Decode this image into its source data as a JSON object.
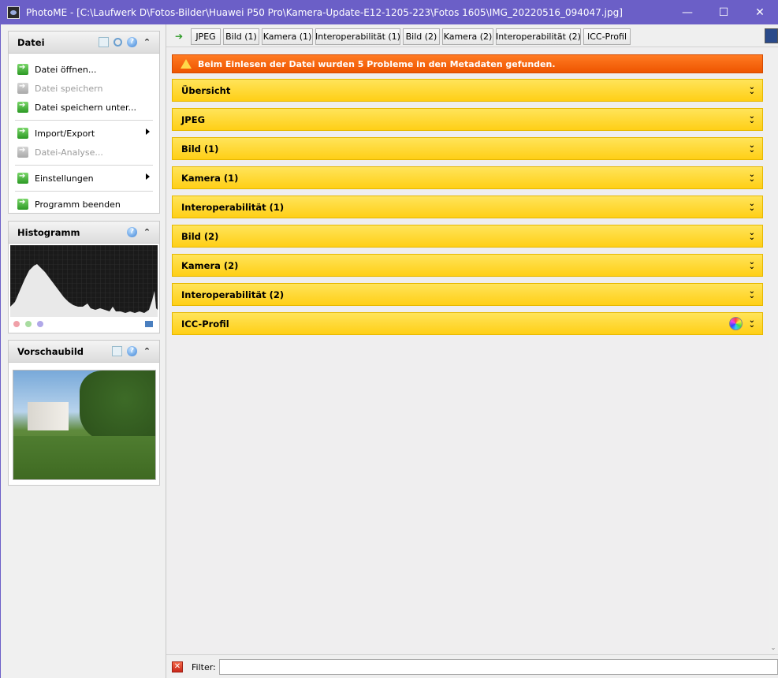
{
  "window": {
    "title": "PhotoME - [C:\\Laufwerk  D\\Fotos-Bilder\\Huawei P50 Pro\\Kamera-Update-E12-1205-223\\Fotos 1605\\IMG_20220516_094047.jpg]",
    "minimize_glyph": "—",
    "maximize_glyph": "☐",
    "close_glyph": "✕"
  },
  "sidebar": {
    "datei": {
      "title": "Datei",
      "items": [
        {
          "label": "Datei öffnen...",
          "enabled": true
        },
        {
          "label": "Datei speichern",
          "enabled": false
        },
        {
          "label": "Datei speichern unter...",
          "enabled": true
        },
        {
          "label": "Import/Export",
          "enabled": true,
          "submenu": true
        },
        {
          "label": "Datei-Analyse...",
          "enabled": false
        },
        {
          "label": "Einstellungen",
          "enabled": true,
          "submenu": true
        },
        {
          "label": "Programm beenden",
          "enabled": true
        }
      ]
    },
    "histogram": {
      "title": "Histogramm",
      "channel_colors": [
        "#f0a0a8",
        "#a8dca0",
        "#b0a8e8"
      ]
    },
    "preview": {
      "title": "Vorschaubild"
    }
  },
  "toolbar": {
    "tabs": [
      "JPEG",
      "Bild (1)",
      "Kamera (1)",
      "Interoperabilität (1)",
      "Bild (2)",
      "Kamera (2)",
      "Interoperabilität (2)",
      "ICC-Profil"
    ]
  },
  "warning": {
    "text": "Beim Einlesen der Datei wurden 5 Probleme in den Metadaten gefunden."
  },
  "sections": [
    "Übersicht",
    "JPEG",
    "Bild (1)",
    "Kamera (1)",
    "Interoperabilität (1)",
    "Bild (2)",
    "Kamera (2)",
    "Interoperabilität (2)",
    "ICC-Profil"
  ],
  "filter": {
    "label": "Filter:",
    "value": ""
  },
  "colors": {
    "titlebar": "#6b5fc7",
    "warning": "#ee5500",
    "section": "#ffd52a"
  }
}
